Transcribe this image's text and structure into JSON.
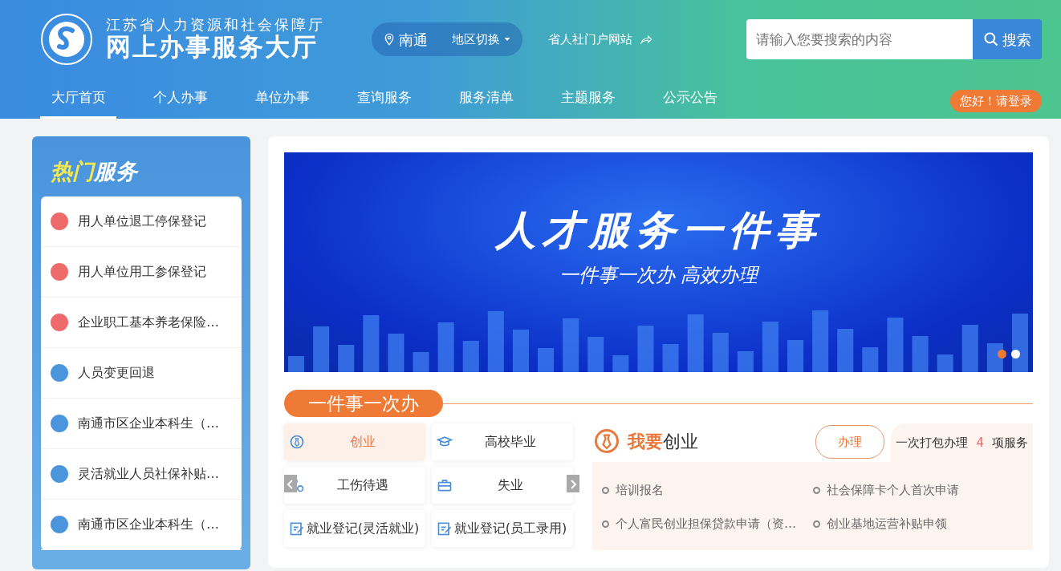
{
  "header": {
    "org": "江苏省人力资源和社会保障厅",
    "title": "网上办事服务大厅",
    "city": "南通",
    "region_switch": "地区切换",
    "portal_link": "省人社门户网站",
    "search": {
      "placeholder": "请输入您要搜索的内容",
      "button": "搜索"
    }
  },
  "nav": [
    {
      "label": "大厅首页",
      "selected": true
    },
    {
      "label": "个人办事",
      "selected": false
    },
    {
      "label": "单位办事",
      "selected": false
    },
    {
      "label": "查询服务",
      "selected": false
    },
    {
      "label": "服务清单",
      "selected": false
    },
    {
      "label": "主题服务",
      "selected": false
    },
    {
      "label": "公示公告",
      "selected": false
    }
  ],
  "login": "您好！请登录",
  "hot_services": {
    "title_highlight": "热门",
    "title": "服务",
    "items": [
      {
        "label": "用人单位退工停保登记",
        "color": "#ef6b6b"
      },
      {
        "label": "用人单位用工参保登记",
        "color": "#ef6b6b"
      },
      {
        "label": "企业职工基本养老保险…",
        "color": "#ef6b6b"
      },
      {
        "label": "人员变更回退",
        "color": "#4b95dc"
      },
      {
        "label": "南通市区企业本科生（…",
        "color": "#4b95dc"
      },
      {
        "label": "灵活就业人员社保补贴…",
        "color": "#4b95dc"
      },
      {
        "label": "南通市区企业本科生（…",
        "color": "#4b95dc"
      }
    ]
  },
  "banner": {
    "headline": "人才服务一件事",
    "subtitle": "一件事一次办  高效办理",
    "dots": [
      {
        "selected": true
      },
      {
        "selected": false
      }
    ]
  },
  "one_thing": {
    "title": "一件事一次办",
    "tiles": [
      {
        "label": "创业",
        "kind": "startup",
        "selected": true
      },
      {
        "label": "高校毕业",
        "kind": "graduate",
        "selected": false
      },
      {
        "label": "工伤待遇",
        "kind": "injury",
        "selected": false
      },
      {
        "label": "失业",
        "kind": "unemployment",
        "selected": false
      },
      {
        "label": "就业登记(灵活就业)",
        "kind": "registration",
        "selected": false
      },
      {
        "label": "就业登记(员工录用)",
        "kind": "registration",
        "selected": false
      }
    ],
    "detail": {
      "title_highlight": "我要",
      "title": "创业",
      "button": "办理",
      "package_prefix": "一次打包办理",
      "package_count": "4",
      "package_suffix": "项服务",
      "links": [
        "培训报名",
        "社会保障卡个人首次申请",
        "个人富民创业担保贷款申请（资…",
        "创业基地运营补贴申领"
      ]
    }
  }
}
